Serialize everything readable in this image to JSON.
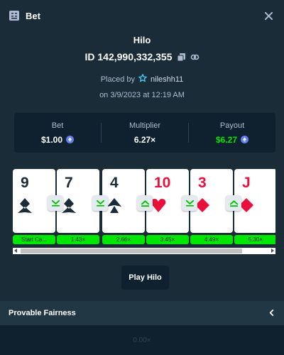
{
  "header": {
    "title": "Bet",
    "icon": "bet-receipt-icon",
    "close_icon": "close-icon"
  },
  "game": {
    "name": "Hilo",
    "id_text": "ID 142,990,332,355",
    "placed_by_prefix": "Placed by",
    "user_icon": "vip-star-icon",
    "username": "nileshh11",
    "date_text": "on 3/9/2023 at 12:19 AM"
  },
  "stats": {
    "bet_label": "Bet",
    "bet_value": "$1.00",
    "multiplier_label": "Multiplier",
    "multiplier_value": "6.27×",
    "payout_label": "Payout",
    "payout_value": "$6.27",
    "currency_icon": "ethereum-icon"
  },
  "cards": [
    {
      "rank": "9",
      "suit": "club",
      "color": "black",
      "multiplier": "Start Ca..."
    },
    {
      "rank": "7",
      "suit": "club",
      "color": "black",
      "multiplier": "1.43×",
      "guess": "lower-or-same"
    },
    {
      "rank": "4",
      "suit": "spade",
      "color": "black",
      "multiplier": "2.66×",
      "guess": "lower-or-same"
    },
    {
      "rank": "10",
      "suit": "heart",
      "color": "red",
      "multiplier": "3.45×",
      "guess": "higher-or-same"
    },
    {
      "rank": "3",
      "suit": "diamond",
      "color": "red",
      "multiplier": "4.49×",
      "guess": "lower-or-same"
    },
    {
      "rank": "J",
      "suit": "diamond",
      "color": "red",
      "multiplier": "5.30×",
      "guess": "higher-or-same"
    }
  ],
  "play_button": "Play Hilo",
  "fairness": {
    "label": "Provable Fairness",
    "icon": "chevron-left-icon"
  },
  "bottom": {
    "text": "0.00×"
  },
  "colors": {
    "background": "#1a2c38",
    "panel": "#0f212e",
    "accent_green": "#00e701",
    "red_suit": "#e9113c",
    "muted_text": "#b1bad3"
  }
}
